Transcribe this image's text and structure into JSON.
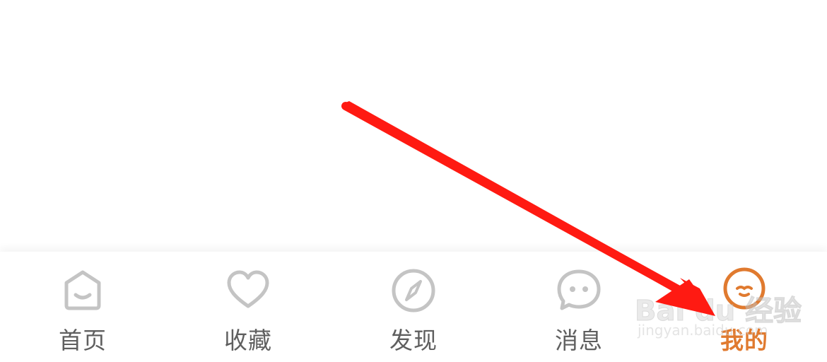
{
  "colors": {
    "inactive": "#c4c4c4",
    "inactive_label": "#5f5f5f",
    "active": "#e07a2f",
    "annotation_arrow": "#ff1a12"
  },
  "tab_bar": {
    "items": [
      {
        "label": "首页",
        "icon": "home-face-icon",
        "active": false
      },
      {
        "label": "收藏",
        "icon": "heart-icon",
        "active": false
      },
      {
        "label": "发现",
        "icon": "compass-icon",
        "active": false
      },
      {
        "label": "消息",
        "icon": "chat-face-icon",
        "active": false
      },
      {
        "label": "我的",
        "icon": "profile-face-icon",
        "active": true
      }
    ]
  },
  "watermark": {
    "logo_text": "Bai du 经验",
    "url": "jingyan.baidu.com"
  },
  "annotation": {
    "type": "arrow",
    "points_to": "tab-profile"
  }
}
